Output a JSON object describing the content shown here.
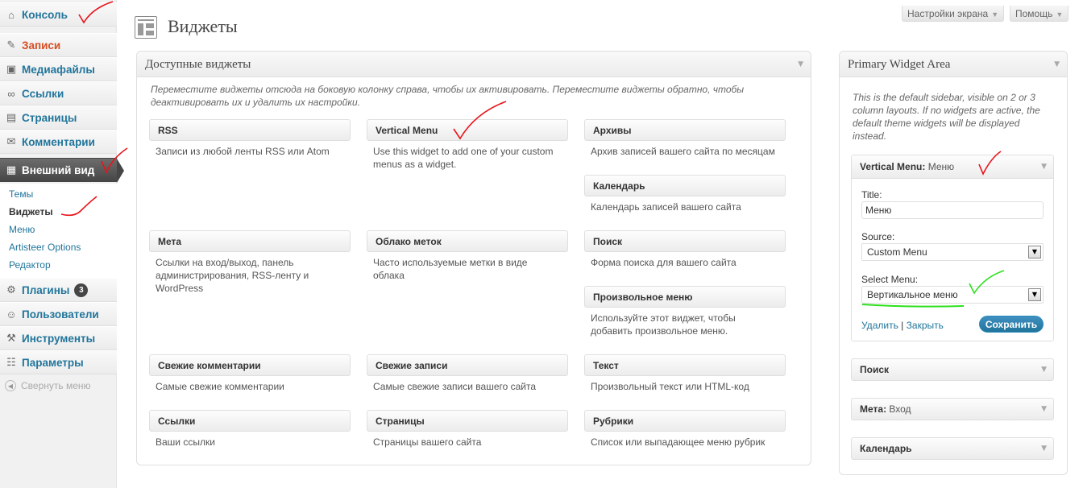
{
  "sidebar": {
    "items": [
      {
        "label": "Консоль",
        "icon": "home-icon"
      },
      {
        "label": "Записи",
        "icon": "pin-icon"
      },
      {
        "label": "Медиафайлы",
        "icon": "media-icon"
      },
      {
        "label": "Ссылки",
        "icon": "link-icon"
      },
      {
        "label": "Страницы",
        "icon": "page-icon"
      },
      {
        "label": "Комментарии",
        "icon": "comment-icon"
      },
      {
        "label": "Внешний вид",
        "icon": "appearance-icon"
      },
      {
        "label": "Плагины",
        "icon": "plugin-icon",
        "badge": "3"
      },
      {
        "label": "Пользователи",
        "icon": "users-icon"
      },
      {
        "label": "Инструменты",
        "icon": "tools-icon"
      },
      {
        "label": "Параметры",
        "icon": "settings-icon"
      }
    ],
    "submenu": [
      "Темы",
      "Виджеты",
      "Меню",
      "Artisteer Options",
      "Редактор"
    ],
    "collapse": "Свернуть меню"
  },
  "header": {
    "title": "Виджеты",
    "screen_options": "Настройки экрана",
    "help": "Помощь"
  },
  "available": {
    "title": "Доступные виджеты",
    "description": "Переместите виджеты отсюда на боковую колонку справа, чтобы их активировать. Переместите виджеты обратно, чтобы деактивировать их и удалить их настройки.",
    "widgets": [
      {
        "name": "RSS",
        "desc": "Записи из любой ленты RSS или Atom"
      },
      {
        "name": "Vertical Menu",
        "desc": "Use this widget to add one of your custom menus as a widget."
      },
      {
        "name": "Архивы",
        "desc": "Архив записей вашего сайта по месяцам"
      },
      {
        "name": "Календарь",
        "desc": "Календарь записей вашего сайта"
      },
      {
        "name": "Мета",
        "desc": "Ссылки на вход/выход, панель администрирования, RSS-ленту и WordPress"
      },
      {
        "name": "Облако меток",
        "desc": "Часто используемые метки в виде облака"
      },
      {
        "name": "Поиск",
        "desc": "Форма поиска для вашего сайта"
      },
      {
        "name": "Произвольное меню",
        "desc": "Используйте этот виджет, чтобы добавить произвольное меню."
      },
      {
        "name": "Свежие комментарии",
        "desc": "Самые свежие комментарии"
      },
      {
        "name": "Свежие записи",
        "desc": "Самые свежие записи вашего сайта"
      },
      {
        "name": "Текст",
        "desc": "Произвольный текст или HTML-код"
      },
      {
        "name": "Ссылки",
        "desc": "Ваши ссылки"
      },
      {
        "name": "Страницы",
        "desc": "Страницы вашего сайта"
      },
      {
        "name": "Рубрики",
        "desc": "Список или выпадающее меню рубрик"
      }
    ]
  },
  "primary": {
    "title": "Primary Widget Area",
    "description": "This is the default sidebar, visible on 2 or 3 column layouts. If no widgets are active, the default theme widgets will be displayed instead.",
    "open_widget": {
      "name": "Vertical Menu:",
      "subtitle": "Меню",
      "title_label": "Title:",
      "title_value": "Меню",
      "source_label": "Source:",
      "source_value": "Custom Menu",
      "select_label": "Select Menu:",
      "select_value": "Вертикальное меню",
      "delete_link": "Удалить",
      "separator": "|",
      "close_link": "Закрыть",
      "save_button": "Сохранить"
    },
    "widgets": [
      {
        "name": "Поиск",
        "sub": ""
      },
      {
        "name": "Мета:",
        "sub": "Вход"
      },
      {
        "name": "Календарь",
        "sub": ""
      }
    ]
  },
  "colors": {
    "link": "#21759b",
    "active_menu": "#464646",
    "annotation_red": "#e8141a",
    "annotation_green": "#2ee01e"
  }
}
